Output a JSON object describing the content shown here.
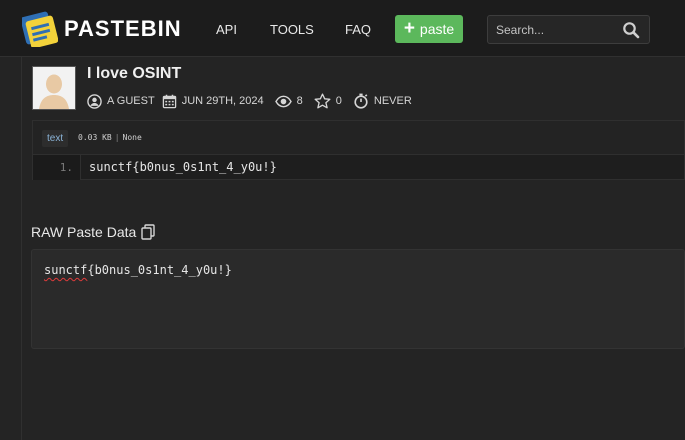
{
  "header": {
    "brand": "PASTEBIN",
    "nav": {
      "api": "API",
      "tools": "TOOLS",
      "faq": "FAQ"
    },
    "paste_button": "paste",
    "search_placeholder": "Search...",
    "accent_color": "#5cb85c"
  },
  "paste": {
    "title": "I love OSINT",
    "author": "A GUEST",
    "date": "JUN 29TH, 2024",
    "views": "8",
    "rating": "0",
    "expiry": "NEVER"
  },
  "code": {
    "syntax": "text",
    "size": "0.03 KB",
    "category": "None",
    "line_number": "1.",
    "line_text": "sunctf{b0nus_0s1nt_4_y0u!}"
  },
  "raw": {
    "heading": "RAW Paste Data",
    "text_underlined": "sunctf",
    "text_rest": "{b0nus_0s1nt_4_y0u!}"
  }
}
